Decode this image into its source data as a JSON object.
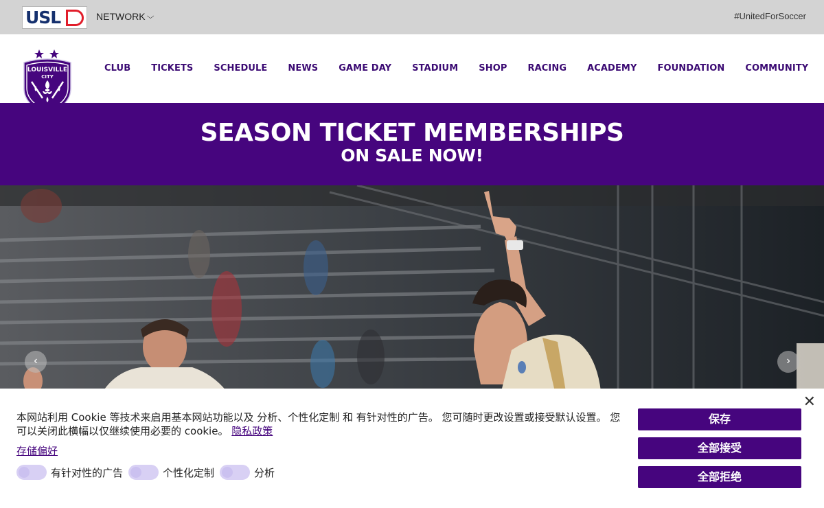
{
  "topbar": {
    "logo_text": "USL",
    "network_label": "NETWORK",
    "hashtag": "#UnitedForSoccer"
  },
  "header": {
    "crest_text": [
      "LOUISVILLE",
      "CITY"
    ],
    "nav": [
      "CLUB",
      "TICKETS",
      "SCHEDULE",
      "NEWS",
      "GAME DAY",
      "STADIUM",
      "SHOP",
      "RACING",
      "ACADEMY",
      "FOUNDATION",
      "COMMUNITY"
    ]
  },
  "banner": {
    "title": "SEASON TICKET MEMBERSHIPS",
    "subtitle": "ON SALE NOW!"
  },
  "hero": {
    "prev_label": "‹",
    "next_label": "›"
  },
  "cookie": {
    "text_1": "本网站利用 Cookie 等技术来启用基本网站功能以及 分析、个性化定制 和 有针对性的广告。 您可随时更改设置或接受默认设置。 您可以关闭此横幅以仅继续使用必要的 cookie。",
    "privacy_link": "隐私政策",
    "pref_link": "存储偏好",
    "toggles": [
      "有针对性的广告",
      "个性化定制",
      "分析"
    ],
    "buttons": {
      "save": "保存",
      "accept_all": "全部接受",
      "reject_all": "全部拒绝"
    },
    "close": "✕"
  },
  "colors": {
    "brand_purple": "#46057e",
    "nav_text": "#3b0a73",
    "topbar_bg": "#d3d3d3",
    "usl_navy": "#15306e",
    "usl_red": "#e11d2a"
  }
}
